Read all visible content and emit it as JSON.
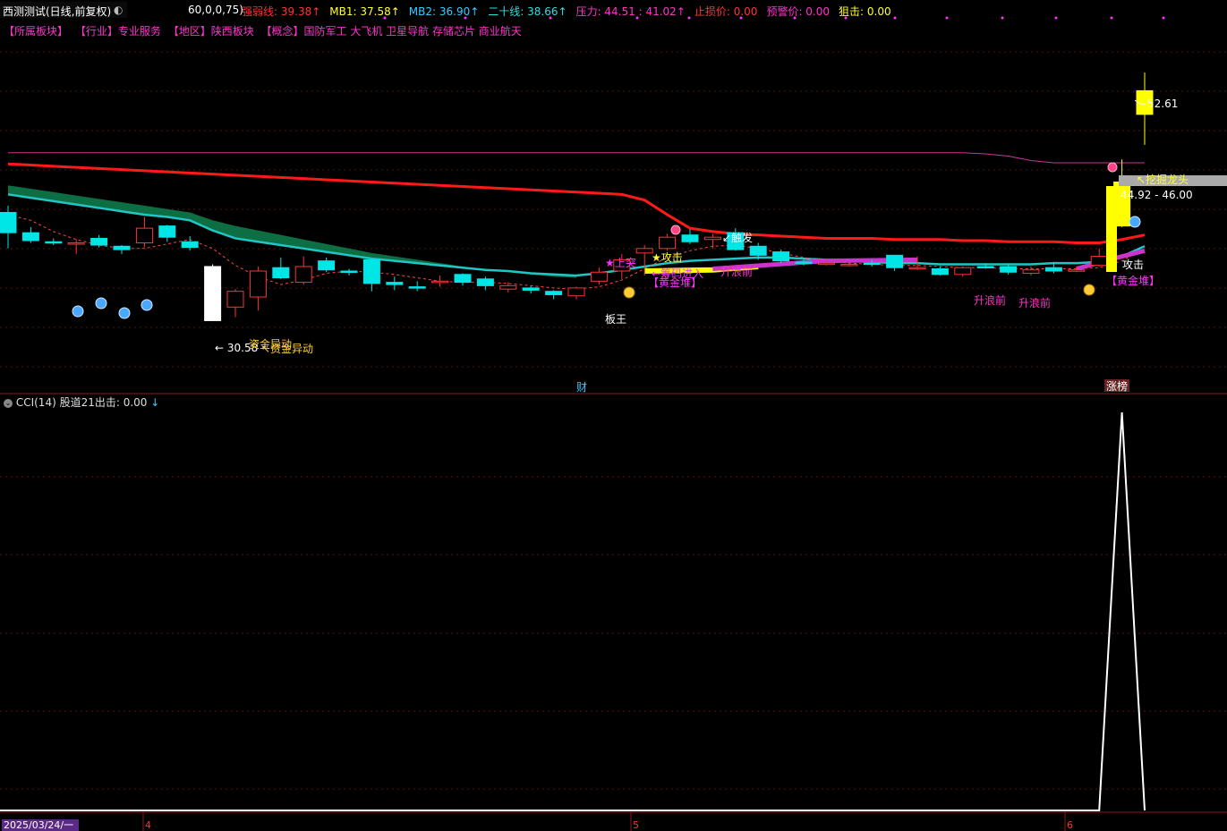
{
  "header": {
    "title": "西测测试(日线,前复权)",
    "params": "60,0,0,75)",
    "indicators": [
      {
        "label": "强弱线: 39.38",
        "arrow": "↑",
        "color": "#ff3333"
      },
      {
        "label": "MB1: 37.58",
        "arrow": "↑",
        "color": "#ffff33"
      },
      {
        "label": "MB2: 36.90",
        "arrow": "↑",
        "color": "#33ccff"
      },
      {
        "label": "二十线: 38.66",
        "arrow": "↑",
        "color": "#33dddd"
      },
      {
        "label": "压力: 44.51 : 41.02",
        "arrow": "↑",
        "color": "#ff33cc"
      },
      {
        "label": "止损价: 0.00",
        "arrow": "",
        "color": "#ff3333"
      },
      {
        "label": "预警价: 0.00",
        "arrow": "",
        "color": "#ff33cc"
      },
      {
        "label": "狙击: 0.00",
        "arrow": "",
        "color": "#ffff33"
      }
    ]
  },
  "sectors": [
    "【所属板块】",
    "【行业】专业服务",
    "【地区】陕西板块",
    "【概念】国防军工 大飞机 卫星导航 存储芯片 商业航天"
  ],
  "annotations": {
    "low_price": "← 30.58",
    "fund_move_1": "资金异动",
    "fund_move_2": "↖资金异动",
    "up_break": "★上突",
    "attack_1": "★攻击",
    "chip_enter": "←筹码进入",
    "gold_pile_1": "【黄金堆】",
    "board_king": "板王",
    "trigger": "↙触发",
    "rise_wave_1": "升浪前",
    "rise_wave_2": "升浪前",
    "rise_wave_3": "升浪前",
    "attack_2": "攻击",
    "gold_pile_2": "【黄金堆】",
    "dig_dragon": "↖挖掘龙头",
    "price_range": "44.92 - 46.00",
    "high_price": "52.61",
    "cai": "财",
    "zhangbang": "涨榜"
  },
  "sub_panel": {
    "label": "CCI(14)  股道21出击: 0.00",
    "arrow": "↓"
  },
  "date_label": "2025/03/24/一",
  "month_marks": [
    "4",
    "5",
    "6"
  ],
  "colors": {
    "up": "#ff3333",
    "down": "#00e5e5",
    "strong_line": "#ff1a1a",
    "band": "#0e7a4a",
    "ma_cyan": "#22c5c5",
    "pressure": "#cc3399",
    "yellow": "#ffff00",
    "magenta": "#cc33cc"
  },
  "chart_data": {
    "type": "candlestick",
    "y_axis_printed": false,
    "ylim": [
      28,
      56
    ],
    "candles": [
      {
        "o": 40.2,
        "c": 38.4,
        "h": 40.8,
        "l": 37.0
      },
      {
        "o": 38.4,
        "c": 37.7,
        "h": 38.9,
        "l": 37.5
      },
      {
        "o": 37.6,
        "c": 37.5,
        "h": 37.9,
        "l": 37.3
      },
      {
        "o": 37.4,
        "c": 37.5,
        "h": 37.8,
        "l": 36.5
      },
      {
        "o": 37.9,
        "c": 37.3,
        "h": 38.2,
        "l": 37.1
      },
      {
        "o": 37.2,
        "c": 36.9,
        "h": 37.3,
        "l": 36.5
      },
      {
        "o": 37.5,
        "c": 38.8,
        "h": 39.8,
        "l": 37.1
      },
      {
        "o": 39.0,
        "c": 38.0,
        "h": 39.1,
        "l": 37.6
      },
      {
        "o": 37.6,
        "c": 37.1,
        "h": 38.1,
        "l": 36.8
      },
      {
        "o": 35.4,
        "c": 30.6,
        "h": 35.6,
        "l": 30.58
      },
      {
        "o": 31.8,
        "c": 33.2,
        "h": 33.4,
        "l": 30.9
      },
      {
        "o": 32.7,
        "c": 35.0,
        "h": 35.4,
        "l": 31.5
      },
      {
        "o": 35.3,
        "c": 34.4,
        "h": 36.2,
        "l": 34.3
      },
      {
        "o": 34.0,
        "c": 35.4,
        "h": 36.3,
        "l": 33.8
      },
      {
        "o": 35.9,
        "c": 35.1,
        "h": 36.2,
        "l": 34.9
      },
      {
        "o": 35.0,
        "c": 34.9,
        "h": 35.2,
        "l": 34.6
      },
      {
        "o": 36.0,
        "c": 33.9,
        "h": 36.1,
        "l": 33.2
      },
      {
        "o": 34.0,
        "c": 33.8,
        "h": 34.5,
        "l": 33.3
      },
      {
        "o": 33.6,
        "c": 33.5,
        "h": 34.1,
        "l": 33.2
      },
      {
        "o": 34.0,
        "c": 34.1,
        "h": 34.6,
        "l": 33.6
      },
      {
        "o": 34.7,
        "c": 34.0,
        "h": 34.8,
        "l": 33.7
      },
      {
        "o": 34.3,
        "c": 33.7,
        "h": 34.5,
        "l": 33.3
      },
      {
        "o": 33.4,
        "c": 33.7,
        "h": 34.0,
        "l": 33.1
      },
      {
        "o": 33.5,
        "c": 33.3,
        "h": 33.7,
        "l": 33.0
      },
      {
        "o": 33.2,
        "c": 32.9,
        "h": 33.3,
        "l": 32.5
      },
      {
        "o": 32.8,
        "c": 33.5,
        "h": 33.6,
        "l": 32.5
      },
      {
        "o": 34.1,
        "c": 34.9,
        "h": 35.3,
        "l": 33.8
      },
      {
        "o": 35.0,
        "c": 36.0,
        "h": 36.5,
        "l": 34.3
      },
      {
        "o": 36.6,
        "c": 37.0,
        "h": 37.3,
        "l": 34.6
      },
      {
        "o": 37.0,
        "c": 38.0,
        "h": 38.3,
        "l": 36.8
      },
      {
        "o": 38.2,
        "c": 37.6,
        "h": 38.7,
        "l": 37.4
      },
      {
        "o": 37.8,
        "c": 38.0,
        "h": 38.3,
        "l": 37.0
      },
      {
        "o": 38.4,
        "c": 36.9,
        "h": 38.8,
        "l": 36.8
      },
      {
        "o": 37.2,
        "c": 36.4,
        "h": 37.5,
        "l": 36.0
      },
      {
        "o": 36.7,
        "c": 35.9,
        "h": 36.9,
        "l": 35.7
      },
      {
        "o": 35.8,
        "c": 35.7,
        "h": 36.0,
        "l": 35.5
      },
      {
        "o": 35.7,
        "c": 35.7,
        "h": 35.9,
        "l": 35.5
      },
      {
        "o": 35.6,
        "c": 35.6,
        "h": 35.8,
        "l": 35.4
      },
      {
        "o": 35.7,
        "c": 35.6,
        "h": 36.0,
        "l": 35.4
      },
      {
        "o": 36.4,
        "c": 35.3,
        "h": 36.4,
        "l": 35.0
      },
      {
        "o": 35.3,
        "c": 35.3,
        "h": 36.3,
        "l": 35.1
      },
      {
        "o": 35.2,
        "c": 34.7,
        "h": 35.4,
        "l": 34.6
      },
      {
        "o": 34.7,
        "c": 35.3,
        "h": 35.4,
        "l": 34.5
      },
      {
        "o": 35.4,
        "c": 35.3,
        "h": 35.7,
        "l": 35.2
      },
      {
        "o": 35.4,
        "c": 34.9,
        "h": 35.6,
        "l": 34.7
      },
      {
        "o": 34.8,
        "c": 35.1,
        "h": 35.4,
        "l": 34.6
      },
      {
        "o": 35.3,
        "c": 35.0,
        "h": 35.8,
        "l": 34.8
      },
      {
        "o": 35.0,
        "c": 35.1,
        "h": 35.4,
        "l": 34.9
      },
      {
        "o": 35.5,
        "c": 36.3,
        "h": 37.0,
        "l": 35.4
      },
      {
        "o": 39.0,
        "c": 42.9,
        "h": 44.9,
        "l": 38.9
      },
      {
        "o": 48.9,
        "c": 51.0,
        "h": 52.61,
        "l": 46.2
      }
    ],
    "strong_line": [
      44.5,
      44.4,
      44.3,
      44.2,
      44.1,
      44.0,
      43.9,
      43.8,
      43.7,
      43.6,
      43.5,
      43.4,
      43.3,
      43.2,
      43.1,
      43.0,
      42.9,
      42.8,
      42.7,
      42.6,
      42.5,
      42.4,
      42.3,
      42.2,
      42.1,
      42.0,
      41.9,
      41.8,
      41.3,
      40.0,
      38.8,
      38.5,
      38.3,
      38.2,
      38.1,
      38.0,
      37.9,
      37.9,
      37.9,
      37.8,
      37.8,
      37.8,
      37.7,
      37.7,
      37.6,
      37.6,
      37.6,
      37.5,
      37.5,
      37.8,
      38.2
    ],
    "ma_cyan": [
      41.8,
      41.5,
      41.2,
      40.9,
      40.6,
      40.3,
      40.0,
      39.8,
      39.5,
      38.6,
      37.9,
      37.6,
      37.3,
      37.0,
      36.7,
      36.4,
      36.1,
      35.9,
      35.7,
      35.5,
      35.3,
      35.1,
      35.0,
      34.8,
      34.7,
      34.6,
      34.8,
      35.1,
      35.4,
      35.7,
      35.9,
      36.0,
      36.1,
      36.2,
      36.2,
      36.1,
      36.0,
      35.9,
      35.8,
      35.7,
      35.7,
      35.6,
      35.6,
      35.6,
      35.6,
      35.6,
      35.7,
      35.7,
      35.8,
      36.3,
      37.2
    ],
    "band_top": [
      42.6,
      42.3,
      42.0,
      41.7,
      41.4,
      41.1,
      40.8,
      40.5,
      40.2,
      39.5,
      39.0,
      38.6,
      38.2,
      37.8,
      37.4,
      37.0,
      36.6,
      36.3,
      36.0,
      35.7,
      35.4,
      35.1,
      34.9,
      34.7,
      34.5,
      34.4
    ],
    "band_bottom": [
      41.8,
      41.5,
      41.2,
      40.9,
      40.6,
      40.3,
      40.0,
      39.8,
      39.5,
      38.6,
      37.9,
      37.6,
      37.3,
      37.0,
      36.7,
      36.4,
      36.1,
      35.9,
      35.7,
      35.5,
      35.3,
      35.1,
      35.0,
      34.8,
      34.7,
      34.6
    ],
    "pressure": [
      45.5,
      45.5,
      45.5,
      45.5,
      45.5,
      45.5,
      45.5,
      45.5,
      45.5,
      45.5,
      45.5,
      45.5,
      45.5,
      45.5,
      45.5,
      45.5,
      45.5,
      45.5,
      45.5,
      45.5,
      45.5,
      45.5,
      45.5,
      45.5,
      45.5,
      45.5,
      45.5,
      45.5,
      45.5,
      45.5,
      45.5,
      45.5,
      45.5,
      45.5,
      45.5,
      45.5,
      45.5,
      45.5,
      45.5,
      45.5,
      45.5,
      45.5,
      45.5,
      45.4,
      45.2,
      44.8,
      44.6,
      44.6,
      44.6,
      44.6,
      44.6
    ],
    "dashed_ma": [
      40.0,
      39.5,
      38.5,
      37.8,
      37.3,
      37.0,
      37.0,
      37.4,
      37.8,
      37.0,
      35.5,
      34.5,
      33.8,
      34.2,
      34.8,
      35.0,
      34.9,
      34.7,
      34.4,
      34.1,
      34.0,
      34.0,
      33.9,
      33.7,
      33.5,
      33.4,
      33.6,
      34.2,
      35.2,
      36.2,
      36.8,
      37.2,
      37.3,
      37.0,
      36.6,
      36.2,
      35.9,
      35.7,
      35.6,
      35.5,
      35.5,
      35.4,
      35.3,
      35.3,
      35.2,
      35.2,
      35.2,
      35.2,
      35.3,
      35.9,
      37.0
    ],
    "cci": [
      0,
      0,
      0,
      0,
      0,
      0,
      0,
      0,
      0,
      0,
      0,
      0,
      0,
      0,
      0,
      0,
      0,
      0,
      0,
      0,
      0,
      0,
      0,
      0,
      0,
      0,
      0,
      0,
      0,
      0,
      0,
      0,
      0,
      0,
      0,
      0,
      0,
      0,
      0,
      0,
      0,
      0,
      0,
      0,
      0,
      0,
      0,
      0,
      0,
      100,
      0
    ]
  }
}
